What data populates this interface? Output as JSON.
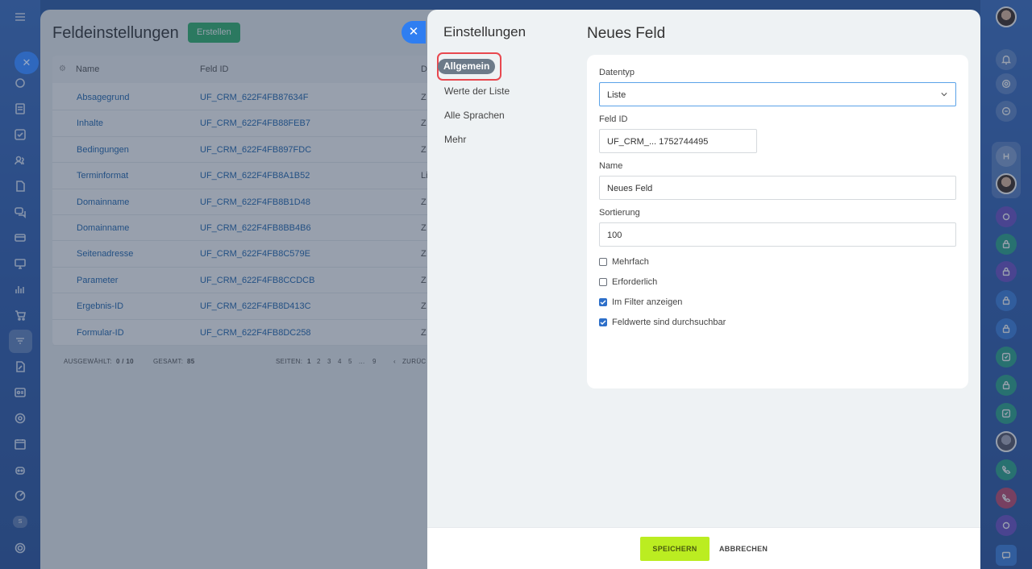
{
  "background_page": {
    "title": "Feldeinstellungen",
    "create_label": "Erstellen",
    "columns": [
      "Name",
      "Feld ID",
      "D"
    ],
    "rows": [
      {
        "name": "Absagegrund",
        "id": "UF_CRM_622F4FB87634F",
        "type": "Z"
      },
      {
        "name": "Inhalte",
        "id": "UF_CRM_622F4FB88FEB7",
        "type": "Z"
      },
      {
        "name": "Bedingungen",
        "id": "UF_CRM_622F4FB897FDC",
        "type": "Z"
      },
      {
        "name": "Terminformat",
        "id": "UF_CRM_622F4FB8A1B52",
        "type": "Li"
      },
      {
        "name": "Domainname",
        "id": "UF_CRM_622F4FB8B1D48",
        "type": "Z"
      },
      {
        "name": "Domainname",
        "id": "UF_CRM_622F4FB8BB4B6",
        "type": "Z"
      },
      {
        "name": "Seitenadresse",
        "id": "UF_CRM_622F4FB8C579E",
        "type": "Z"
      },
      {
        "name": "Parameter",
        "id": "UF_CRM_622F4FB8CCDCB",
        "type": "Z"
      },
      {
        "name": "Ergebnis-ID",
        "id": "UF_CRM_622F4FB8D413C",
        "type": "Z"
      },
      {
        "name": "Formular-ID",
        "id": "UF_CRM_622F4FB8DC258",
        "type": "Z"
      }
    ],
    "footer": {
      "selected_label": "AUSGEWÄHLT:",
      "selected_value": "0 / 10",
      "total_label": "GESAMT:",
      "total_value": "85",
      "pages_label": "SEITEN:",
      "pages": [
        "1",
        "2",
        "3",
        "4",
        "5",
        "...",
        "9"
      ],
      "back_label": "ZURÜC"
    }
  },
  "slider": {
    "nav_title": "Einstellungen",
    "nav_items": [
      "Allgemein",
      "Werte der Liste",
      "Alle Sprachen",
      "Mehr"
    ],
    "main_title": "Neues Feld",
    "form": {
      "datatype_label": "Datentyp",
      "datatype_value": "Liste",
      "field_id_label": "Feld ID",
      "field_id_value": "UF_CRM_... 1752744495",
      "name_label": "Name",
      "name_value": "Neues Feld",
      "sort_label": "Sortierung",
      "sort_value": "100",
      "checkboxes": [
        {
          "label": "Mehrfach",
          "checked": false
        },
        {
          "label": "Erforderlich",
          "checked": false
        },
        {
          "label": "Im Filter anzeigen",
          "checked": true
        },
        {
          "label": "Feldwerte sind durchsuchbar",
          "checked": true
        }
      ]
    },
    "save_label": "SPEICHERN",
    "cancel_label": "ABBRECHEN"
  },
  "colors": {
    "accent": "#2f7ef1",
    "save": "#bbed21",
    "create": "#2fb56c",
    "highlight": "#e8484f"
  }
}
